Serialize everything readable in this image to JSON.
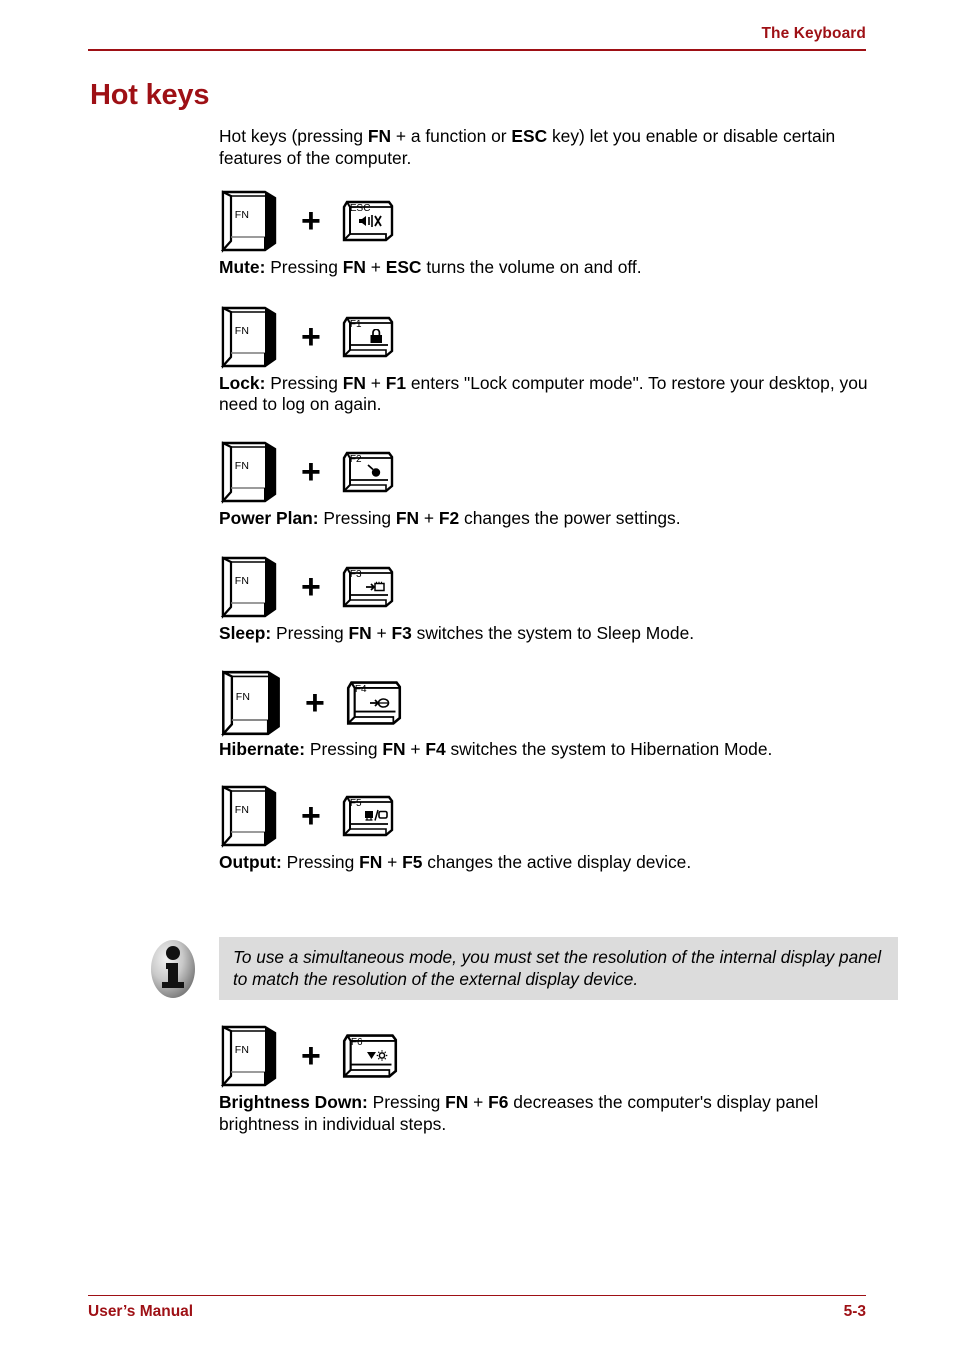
{
  "header": {
    "title": "The Keyboard"
  },
  "section": {
    "title": "Hot keys"
  },
  "intro": {
    "text_html": "Hot keys (pressing <b>FN</b> + a function or <b>ESC</b> key) let you enable or disable certain features of the computer."
  },
  "fn_key": {
    "label": "FN",
    "icon": "fn-keycap-icon"
  },
  "plus_symbol": "+",
  "hotkeys": [
    {
      "key_label": "ESC",
      "key_icon": "mute-speaker-icon",
      "name": "Mute",
      "description_html": "<b>Mute:</b> Pressing <b>FN</b> + <b>ESC</b> turns the volume on and off."
    },
    {
      "key_label": "F1",
      "key_icon": "padlock-icon",
      "name": "Lock",
      "description_html": "<b>Lock:</b> Pressing <b>FN</b> + <b>F1</b> enters \"Lock computer mode\". To restore your desktop, you need to log on again."
    },
    {
      "key_label": "F2",
      "key_icon": "power-plug-icon",
      "name": "Power Plan",
      "description_html": "<b>Power Plan:</b> Pressing <b>FN</b> + <b>F2</b> changes the power settings."
    },
    {
      "key_label": "F3",
      "key_icon": "sleep-memory-icon",
      "name": "Sleep",
      "description_html": "<b>Sleep:</b> Pressing <b>FN</b> + <b>F3</b> switches the system to Sleep Mode."
    },
    {
      "key_label": "F4",
      "key_icon": "hibernate-disk-icon",
      "name": "Hibernate",
      "description_html": "<b>Hibernate:</b> Pressing <b>FN</b> + <b>F4</b> switches the system to Hibernation Mode."
    },
    {
      "key_label": "F5",
      "key_icon": "display-output-icon",
      "name": "Output",
      "description_html": "<b>Output:</b> Pressing <b>FN</b> + <b>F5</b> changes the active display device."
    },
    {
      "key_label": "F6",
      "key_icon": "brightness-down-icon",
      "name": "Brightness Down",
      "description_html": "<b>Brightness Down:</b> Pressing <b>FN</b> + <b>F6</b> decreases the computer's display panel brightness in individual steps."
    }
  ],
  "note": {
    "icon": "info-icon",
    "text": "To use a simultaneous mode, you must set the resolution of the internal display panel to match the resolution of the external display device."
  },
  "footer": {
    "left": "User’s Manual",
    "right": "5-3"
  },
  "colors": {
    "accent_red": "#9e1015",
    "note_background": "#dcdcdc",
    "text": "#000000",
    "page_background": "#ffffff"
  }
}
